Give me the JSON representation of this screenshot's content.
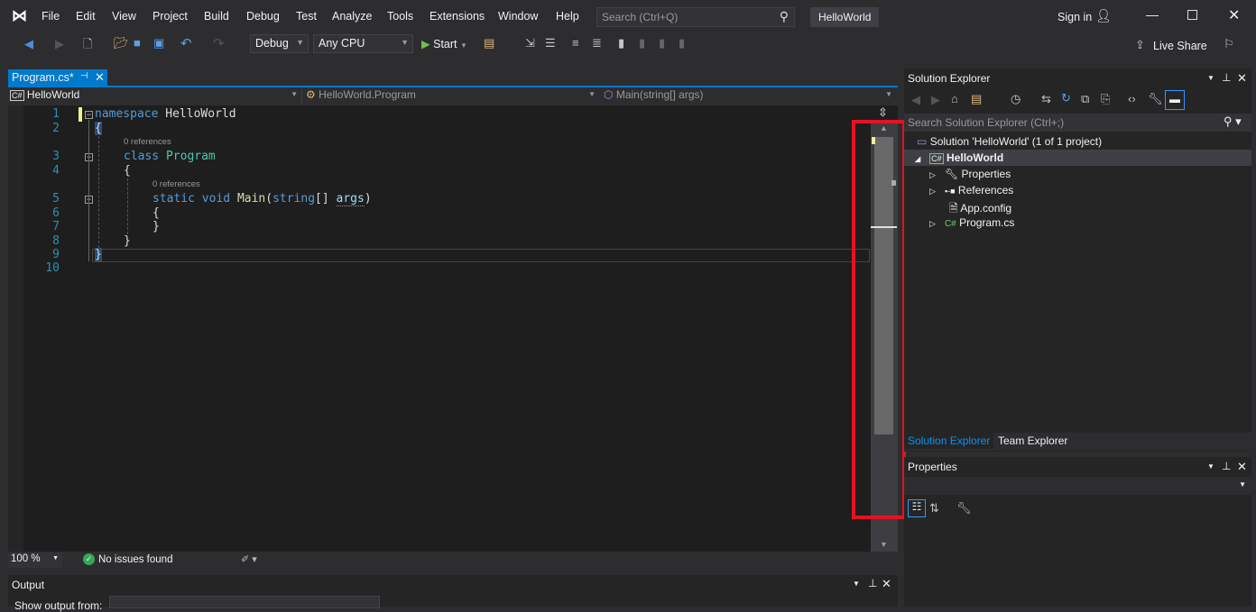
{
  "menu": [
    "File",
    "Edit",
    "View",
    "Project",
    "Build",
    "Debug",
    "Test",
    "Analyze",
    "Tools",
    "Extensions",
    "Window",
    "Help"
  ],
  "search": {
    "placeholder": "Search (Ctrl+Q)"
  },
  "solution_name": "HelloWorld",
  "sign_in": "Sign in",
  "live_share": "Live Share",
  "toolbar": {
    "config": "Debug",
    "platform": "Any CPU",
    "start": "Start"
  },
  "tab": {
    "label": "Program.cs*"
  },
  "nav": {
    "project": "HelloWorld",
    "type": "HelloWorld.Program",
    "member": "Main(string[] args)"
  },
  "code": {
    "lines": [
      "1",
      "2",
      "3",
      "4",
      "5",
      "6",
      "7",
      "8",
      "9",
      "10"
    ],
    "references": "0 references",
    "l1_kw": "namespace",
    "l1_name": "HelloWorld",
    "l2": "{",
    "l3_kw": "class",
    "l3_name": "Program",
    "l4": "{",
    "l5_kw1": "static",
    "l5_kw2": "void",
    "l5_fn": "Main",
    "l5_p1": "(",
    "l5_ty": "string",
    "l5_p2": "[] ",
    "l5_arg": "args",
    "l5_p3": ")",
    "l6": "{",
    "l7": "}",
    "l8": "}",
    "l9": "}"
  },
  "status": {
    "zoom": "100 %",
    "issues": "No issues found"
  },
  "output": {
    "title": "Output",
    "show_from": "Show output from:"
  },
  "solution_explorer": {
    "title": "Solution Explorer",
    "search_placeholder": "Search Solution Explorer (Ctrl+;)",
    "solution": "Solution 'HelloWorld' (1 of 1 project)",
    "project": "HelloWorld",
    "items": [
      "Properties",
      "References",
      "App.config",
      "Program.cs"
    ],
    "tabs": [
      "Solution Explorer",
      "Team Explorer"
    ]
  },
  "properties": {
    "title": "Properties"
  },
  "colors": {
    "accent": "#007acc",
    "highlight_box": "#e81123",
    "editor_bg": "#1e1e1e"
  }
}
